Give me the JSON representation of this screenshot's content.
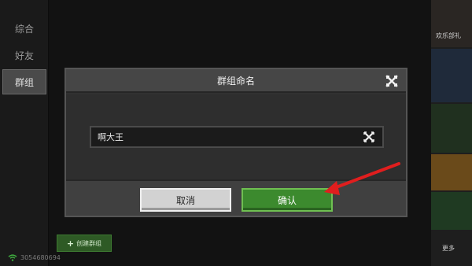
{
  "sidebar": {
    "items": [
      {
        "label": "综合"
      },
      {
        "label": "好友"
      },
      {
        "label": "群组"
      }
    ]
  },
  "create_group_button": {
    "label": "创建群组"
  },
  "status_bar": {
    "id_text": "3054680694"
  },
  "right_panel": {
    "top_label": "欢乐部礼",
    "bottom_label": "更多"
  },
  "dialog": {
    "title": "群组命名",
    "input_value": "啊大王",
    "cancel_label": "取消",
    "confirm_label": "确认"
  },
  "colors": {
    "confirm_green": "#3c8a2e",
    "annotation_arrow": "#e01e1e"
  }
}
